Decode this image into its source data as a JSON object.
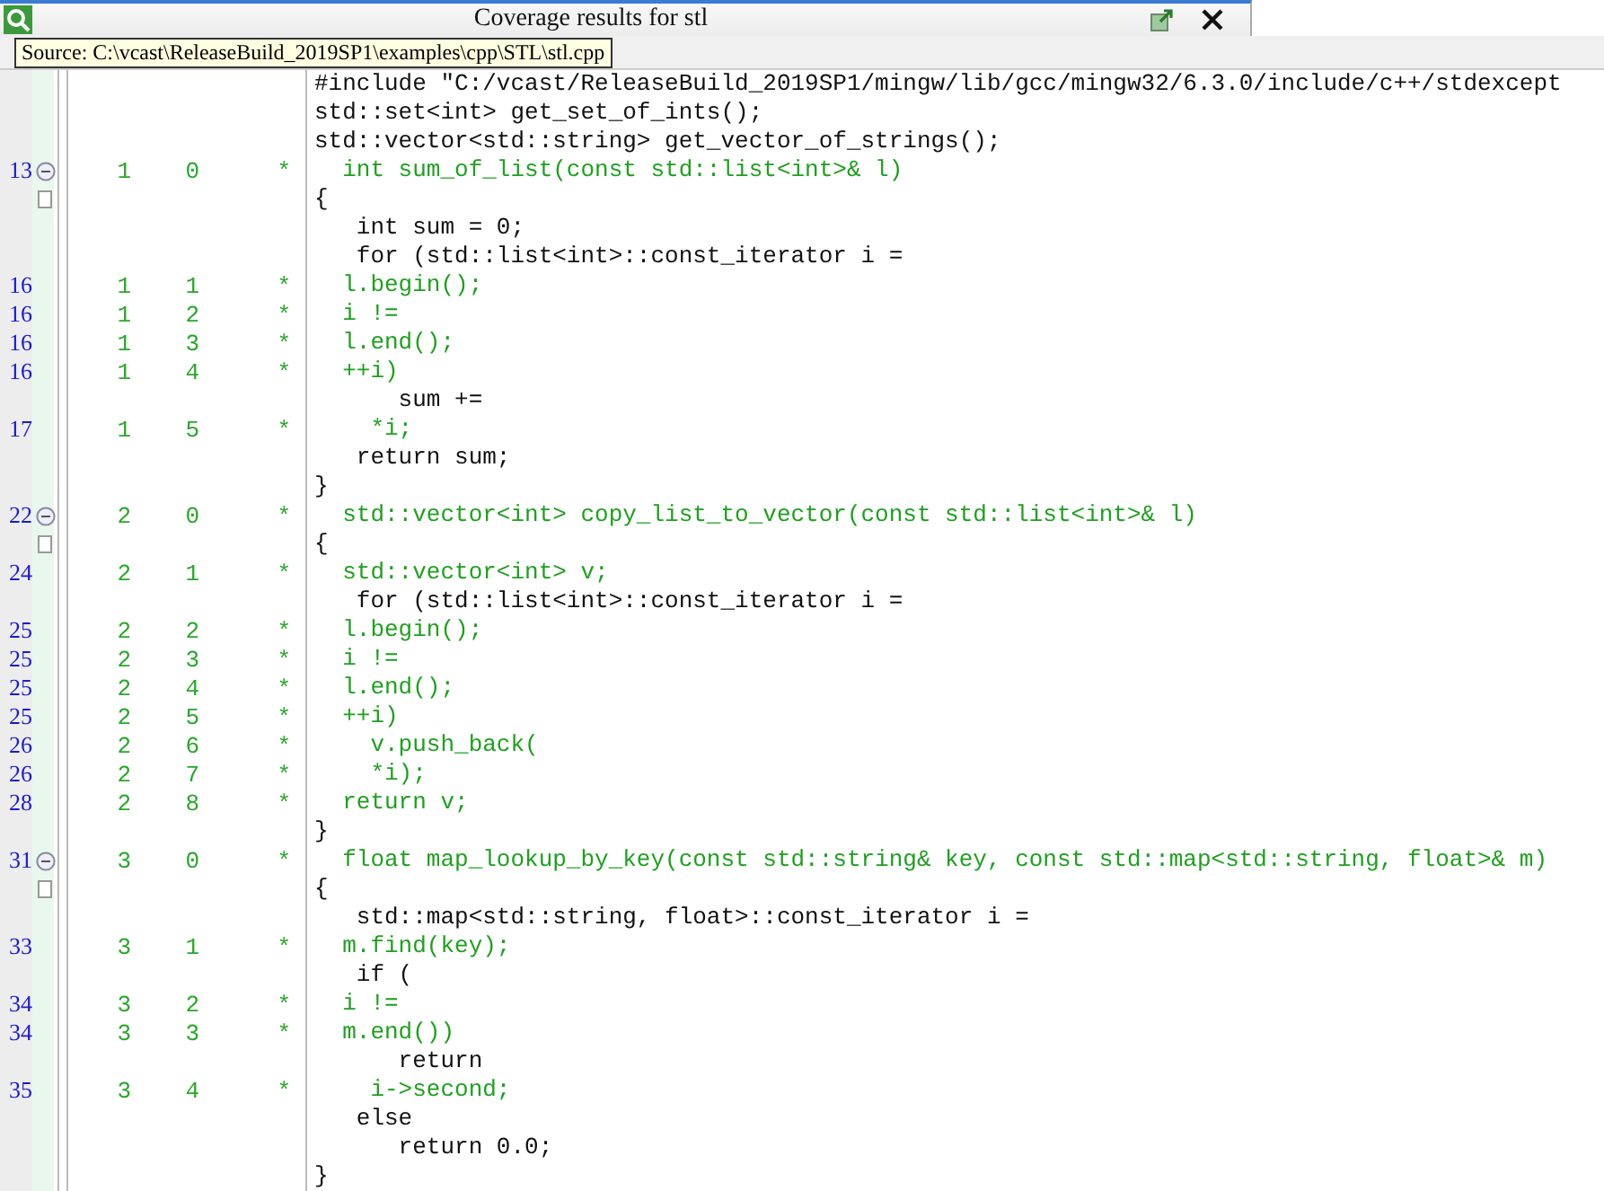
{
  "window": {
    "title": "Coverage results for stl"
  },
  "tooltip": "Source: C:\\vcast\\ReleaseBuild_2019SP1\\examples\\cpp\\STL\\stl.cpp",
  "rows": [
    {
      "code": "#include \"C:/vcast/ReleaseBuild_2019SP1/mingw/lib/gcc/mingw32/6.3.0/include/c++/stdexcept",
      "covered": false
    },
    {
      "code": "std::set<int> get_set_of_ints();",
      "covered": false
    },
    {
      "code": "std::vector<std::string> get_vector_of_strings();",
      "covered": false
    },
    {
      "line": "13",
      "kind": "fold-start",
      "subprogram": "1",
      "statement": "0",
      "star": "*",
      "code": "  int sum_of_list(const std::list<int>& l)",
      "covered": true
    },
    {
      "kind": "fold-end",
      "code": "{",
      "covered": false
    },
    {
      "code": "   int sum = 0;",
      "covered": false
    },
    {
      "code": "   for (std::list<int>::const_iterator i =",
      "covered": false
    },
    {
      "line": "16",
      "subprogram": "1",
      "statement": "1",
      "star": "*",
      "code": "  l.begin();",
      "covered": true
    },
    {
      "line": "16",
      "subprogram": "1",
      "statement": "2",
      "star": "*",
      "code": "  i !=",
      "covered": true
    },
    {
      "line": "16",
      "subprogram": "1",
      "statement": "3",
      "star": "*",
      "code": "  l.end();",
      "covered": true
    },
    {
      "line": "16",
      "subprogram": "1",
      "statement": "4",
      "star": "*",
      "code": "  ++i)",
      "covered": true
    },
    {
      "code": "      sum +=",
      "covered": false
    },
    {
      "line": "17",
      "subprogram": "1",
      "statement": "5",
      "star": "*",
      "code": "    *i;",
      "covered": true
    },
    {
      "code": "   return sum;",
      "covered": false
    },
    {
      "code": "}",
      "covered": false
    },
    {
      "line": "22",
      "kind": "fold-start",
      "subprogram": "2",
      "statement": "0",
      "star": "*",
      "code": "  std::vector<int> copy_list_to_vector(const std::list<int>& l)",
      "covered": true
    },
    {
      "kind": "fold-end",
      "code": "{",
      "covered": false
    },
    {
      "line": "24",
      "subprogram": "2",
      "statement": "1",
      "star": "*",
      "code": "  std::vector<int> v;",
      "covered": true
    },
    {
      "code": "   for (std::list<int>::const_iterator i =",
      "covered": false
    },
    {
      "line": "25",
      "subprogram": "2",
      "statement": "2",
      "star": "*",
      "code": "  l.begin();",
      "covered": true
    },
    {
      "line": "25",
      "subprogram": "2",
      "statement": "3",
      "star": "*",
      "code": "  i !=",
      "covered": true
    },
    {
      "line": "25",
      "subprogram": "2",
      "statement": "4",
      "star": "*",
      "code": "  l.end();",
      "covered": true
    },
    {
      "line": "25",
      "subprogram": "2",
      "statement": "5",
      "star": "*",
      "code": "  ++i)",
      "covered": true
    },
    {
      "line": "26",
      "subprogram": "2",
      "statement": "6",
      "star": "*",
      "code": "    v.push_back(",
      "covered": true
    },
    {
      "line": "26",
      "subprogram": "2",
      "statement": "7",
      "star": "*",
      "code": "    *i);",
      "covered": true
    },
    {
      "line": "28",
      "subprogram": "2",
      "statement": "8",
      "star": "*",
      "code": "  return v;",
      "covered": true
    },
    {
      "code": "}",
      "covered": false
    },
    {
      "line": "31",
      "kind": "fold-start",
      "subprogram": "3",
      "statement": "0",
      "star": "*",
      "code": "  float map_lookup_by_key(const std::string& key, const std::map<std::string, float>& m)",
      "covered": true
    },
    {
      "kind": "fold-end",
      "code": "{",
      "covered": false
    },
    {
      "code": "   std::map<std::string, float>::const_iterator i =",
      "covered": false
    },
    {
      "line": "33",
      "subprogram": "3",
      "statement": "1",
      "star": "*",
      "code": "  m.find(key);",
      "covered": true
    },
    {
      "code": "   if (",
      "covered": false
    },
    {
      "line": "34",
      "subprogram": "3",
      "statement": "2",
      "star": "*",
      "code": "  i !=",
      "covered": true
    },
    {
      "line": "34",
      "subprogram": "3",
      "statement": "3",
      "star": "*",
      "code": "  m.end())",
      "covered": true
    },
    {
      "code": "      return",
      "covered": false
    },
    {
      "line": "35",
      "subprogram": "3",
      "statement": "4",
      "star": "*",
      "code": "    i->second;",
      "covered": true
    },
    {
      "code": "   else",
      "covered": false
    },
    {
      "code": "      return 0.0;",
      "covered": false
    },
    {
      "code": "}",
      "covered": false
    }
  ]
}
